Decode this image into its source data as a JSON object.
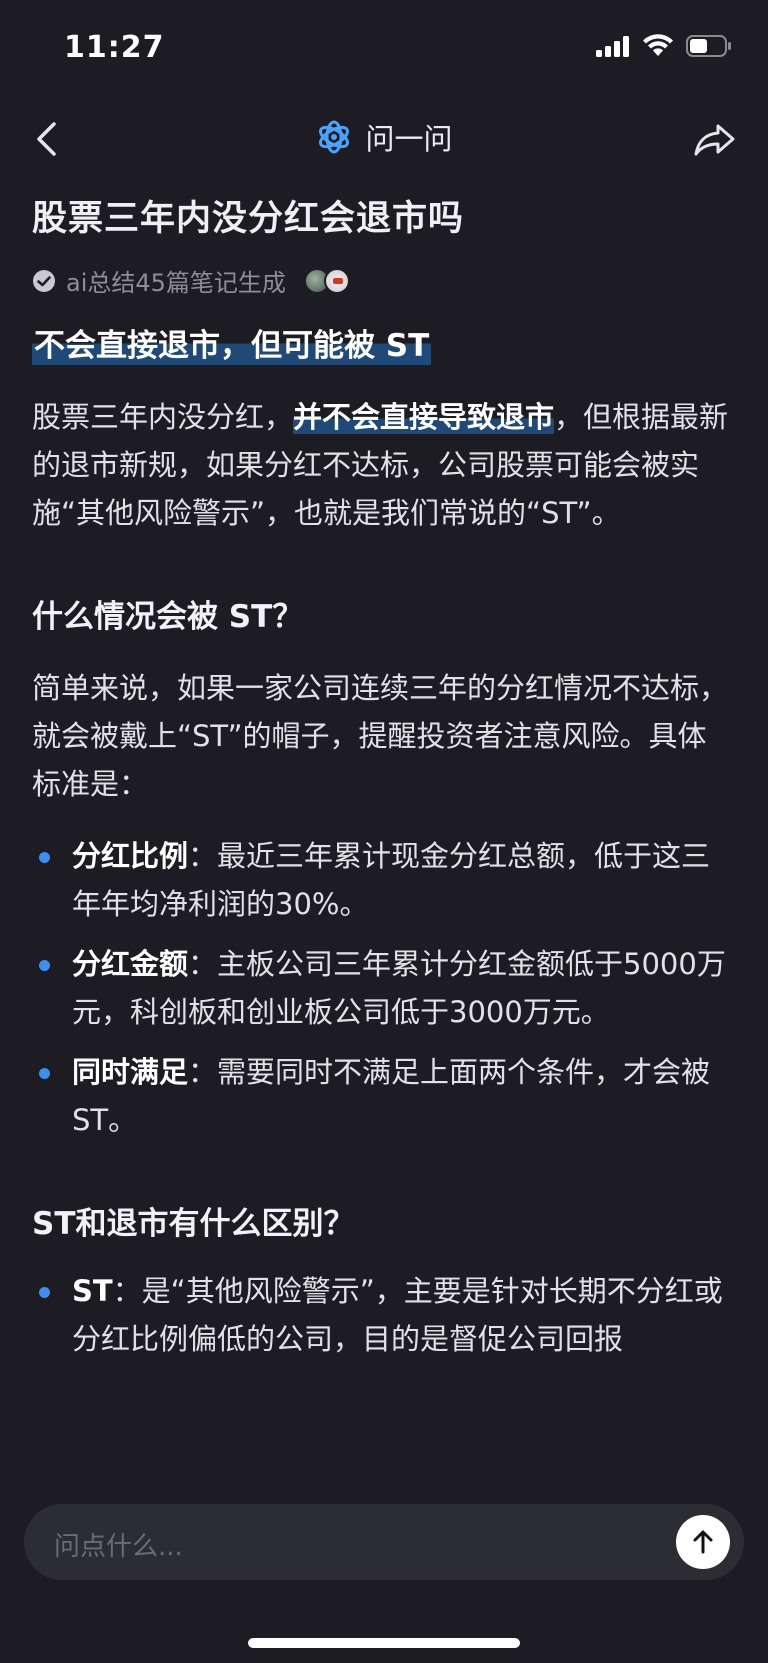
{
  "status_bar": {
    "time": "11:27"
  },
  "nav": {
    "title": "问一问"
  },
  "question": {
    "title": "股票三年内没分红会退市吗",
    "meta": "ai总结45篇笔记生成"
  },
  "answer": {
    "headline": "不会直接退市，但可能被 ST",
    "intro": {
      "before": "股票三年内没分红，",
      "highlight": "并不会直接导致退市",
      "after": "，但根据最新的退市新规，如果分红不达标，公司股票可能会被实施“其他风险警示”，也就是我们常说的“ST”。"
    },
    "section1": {
      "title": "什么情况会被 ST？",
      "para": "简单来说，如果一家公司连续三年的分红情况不达标，就会被戴上“ST”的帽子，提醒投资者注意风险。具体标准是：",
      "bullets": [
        {
          "label": "分红比例",
          "text": "：最近三年累计现金分红总额，低于这三年年均净利润的30%。"
        },
        {
          "label": "分红金额",
          "text": "：主板公司三年累计分红金额低于5000万元，科创板和创业板公司低于3000万元。"
        },
        {
          "label": "同时满足",
          "text": "：需要同时不满足上面两个条件，才会被ST。"
        }
      ]
    },
    "section2": {
      "title": "ST和退市有什么区别？",
      "bullets": [
        {
          "label": "ST",
          "text": "：是“其他风险警示”，主要是针对长期不分红或分红比例偏低的公司，目的是督促公司回报"
        }
      ]
    }
  },
  "input": {
    "placeholder": "问点什么..."
  },
  "colors": {
    "background": "#1c1c22",
    "accent": "#3b8ff0",
    "highlight": "#1f4a78"
  }
}
